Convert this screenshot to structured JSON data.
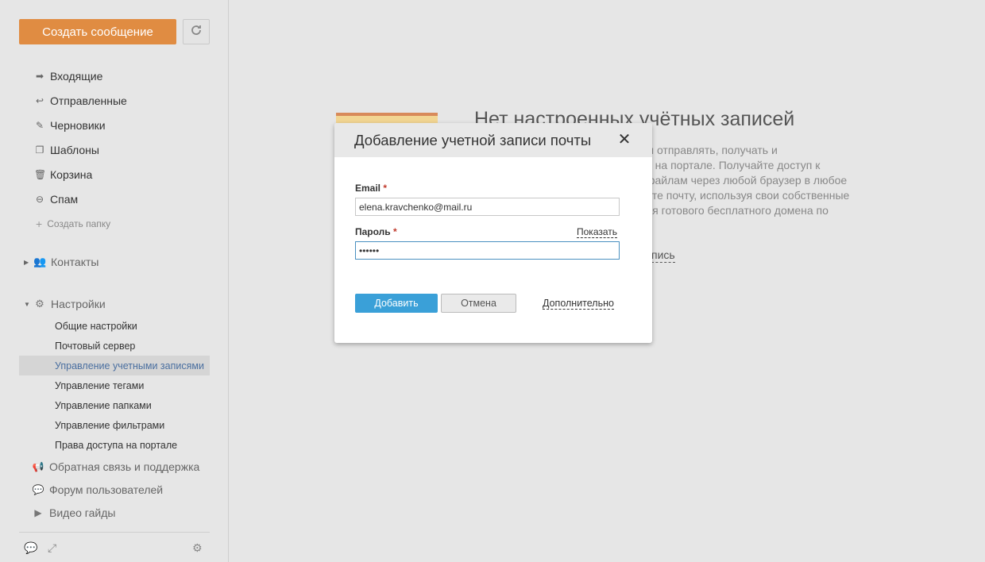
{
  "sidebar": {
    "compose_label": "Создать сообщение",
    "folders": [
      {
        "label": "Входящие",
        "icon": "inbox-arrow-icon"
      },
      {
        "label": "Отправленные",
        "icon": "reply-arrow-icon"
      },
      {
        "label": "Черновики",
        "icon": "draft-edit-icon"
      },
      {
        "label": "Шаблоны",
        "icon": "templates-icon"
      },
      {
        "label": "Корзина",
        "icon": "trash-icon"
      },
      {
        "label": "Спам",
        "icon": "spam-icon"
      }
    ],
    "create_folder": "Создать папку",
    "contacts": "Контакты",
    "settings": "Настройки",
    "settings_items": [
      "Общие настройки",
      "Почтовый сервер",
      "Управление учетными записями",
      "Управление тегами",
      "Управление папками",
      "Управление фильтрами",
      "Права доступа на портале"
    ],
    "support_items": [
      "Обратная связь и поддержка",
      "Форум пользователей",
      "Видео гайды"
    ]
  },
  "main": {
    "empty_title": "Нет настроенных учётных записей",
    "empty_lines": [
      "ы отправлять, получать и",
      "о на портале. Получайте доступ к",
      "файлам через любой браузер в любое",
      "йте почту, используя свои собственные",
      "ля готового бесплатного домена по"
    ],
    "empty_link": "пись"
  },
  "modal": {
    "title": "Добавление учетной записи почты",
    "email_label": "Email",
    "required_mark": "*",
    "email_value": "elena.kravchenko@mail.ru",
    "password_label": "Пароль",
    "show_label": "Показать",
    "password_value": "••••••",
    "add_label": "Добавить",
    "cancel_label": "Отмена",
    "advanced_label": "Дополнительно"
  }
}
